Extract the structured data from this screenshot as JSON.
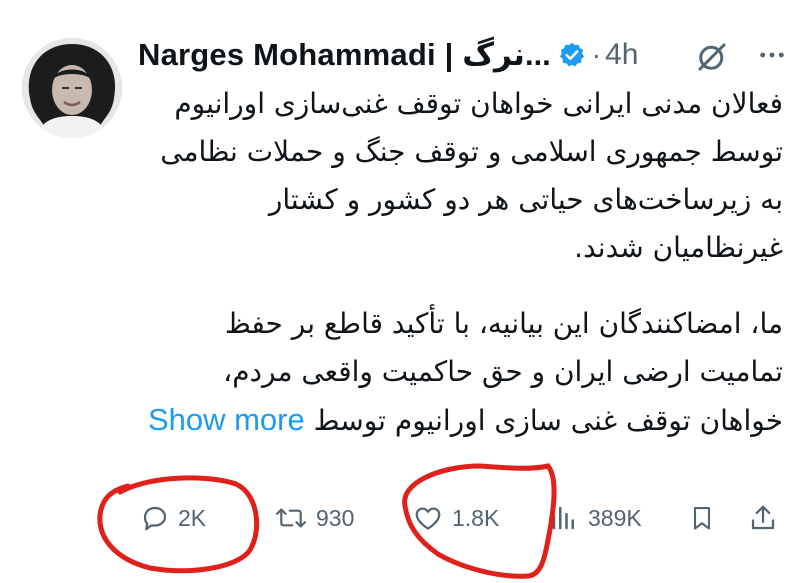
{
  "tweet": {
    "author_name": "Narges Mohammadi | نرگ...",
    "time": "4h",
    "dot": "·",
    "paragraph1": "فعالان مدنی ایرانی خواهان توقف غنی‌سازی اورانیوم توسط جمهوری اسلامی و توقف جنگ و حملات نظامی به زیرساخت‌های حیاتی هر دو کشور و کشتار غیرنظامیان شدند.",
    "paragraph2": "ما، امضاکنندگان این بیانیه، با تأکید قاطع بر حفظ تمامیت ارضی ایران و حق حاکمیت واقعی مردم، خواهان توقف غنی سازی اورانیوم توسط",
    "show_more": "Show more"
  },
  "actions": {
    "replies": "2K",
    "reposts": "930",
    "likes": "1.8K",
    "views": "389K"
  },
  "icons": [
    "avatar",
    "verified-badge-icon",
    "grok-icon",
    "more-icon",
    "reply-icon",
    "repost-icon",
    "like-icon",
    "views-icon",
    "bookmark-icon",
    "share-icon"
  ],
  "colors": {
    "verified": "#1d9bf0",
    "link": "#1d9bf0",
    "muted": "#536471",
    "annotation": "#e0201a"
  }
}
